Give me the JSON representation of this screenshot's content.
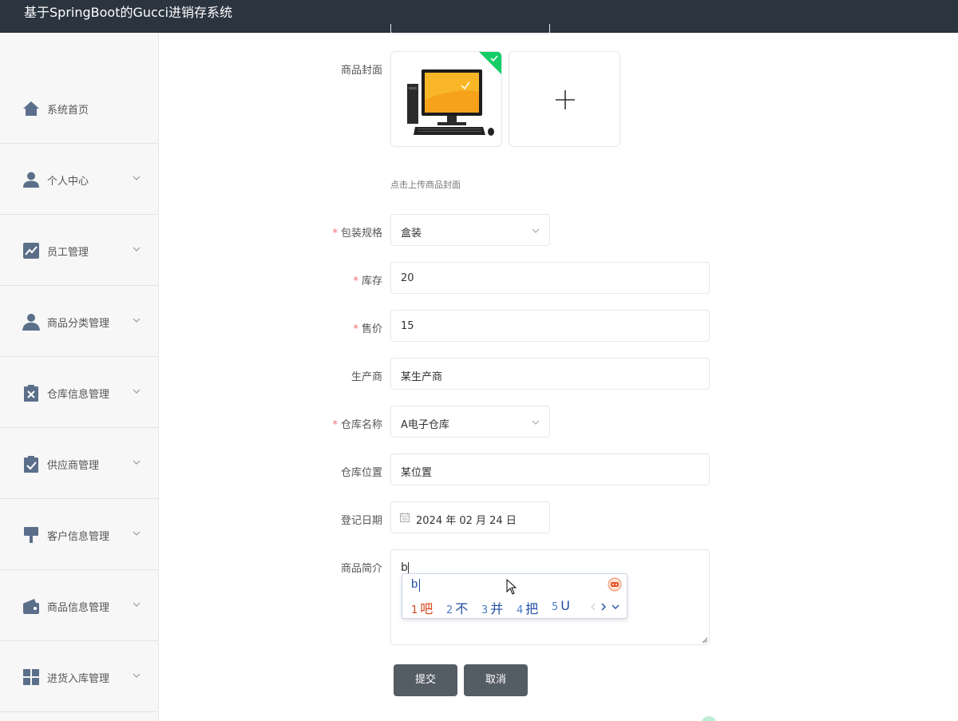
{
  "header": {
    "title": "基于SpringBoot的Gucci进销存系统"
  },
  "sidebar": {
    "items": [
      {
        "label": "系统首页",
        "icon": "home-icon"
      },
      {
        "label": "个人中心",
        "icon": "user-icon"
      },
      {
        "label": "员工管理",
        "icon": "chart-icon"
      },
      {
        "label": "商品分类管理",
        "icon": "person-icon"
      },
      {
        "label": "仓库信息管理",
        "icon": "clipboard-x-icon"
      },
      {
        "label": "供应商管理",
        "icon": "clipboard-check-icon"
      },
      {
        "label": "客户信息管理",
        "icon": "brush-icon"
      },
      {
        "label": "商品信息管理",
        "icon": "wallet-icon"
      },
      {
        "label": "进货入库管理",
        "icon": "grid-icon"
      }
    ]
  },
  "form": {
    "cover_label": "商品封面",
    "cover_tip": "点击上传商品封面",
    "packaging": {
      "label": "包装规格",
      "value": "盒装"
    },
    "stock": {
      "label": "库存",
      "value": "20"
    },
    "price": {
      "label": "售价",
      "value": "15"
    },
    "manufacturer": {
      "label": "生产商",
      "value": "某生产商"
    },
    "warehouse_name": {
      "label": "仓库名称",
      "value": "A电子仓库"
    },
    "warehouse_location": {
      "label": "仓库位置",
      "value": "某位置"
    },
    "register_date": {
      "label": "登记日期",
      "value": "2024 年 02 月 24 日"
    },
    "intro": {
      "label": "商品简介",
      "value": "b"
    },
    "submit_label": "提交",
    "cancel_label": "取消"
  },
  "ime": {
    "composition": "b",
    "candidates": [
      {
        "num": "1",
        "text": "吧"
      },
      {
        "num": "2",
        "text": "不"
      },
      {
        "num": "3",
        "text": "并"
      },
      {
        "num": "4",
        "text": "把"
      },
      {
        "num": "5",
        "text": "U"
      }
    ]
  },
  "colors": {
    "header_bg": "#2b3540",
    "sidebar_bg": "#f7f7f7",
    "button_bg": "#545c64",
    "required": "#f56c6c",
    "upload_badge": "#13ce66"
  }
}
